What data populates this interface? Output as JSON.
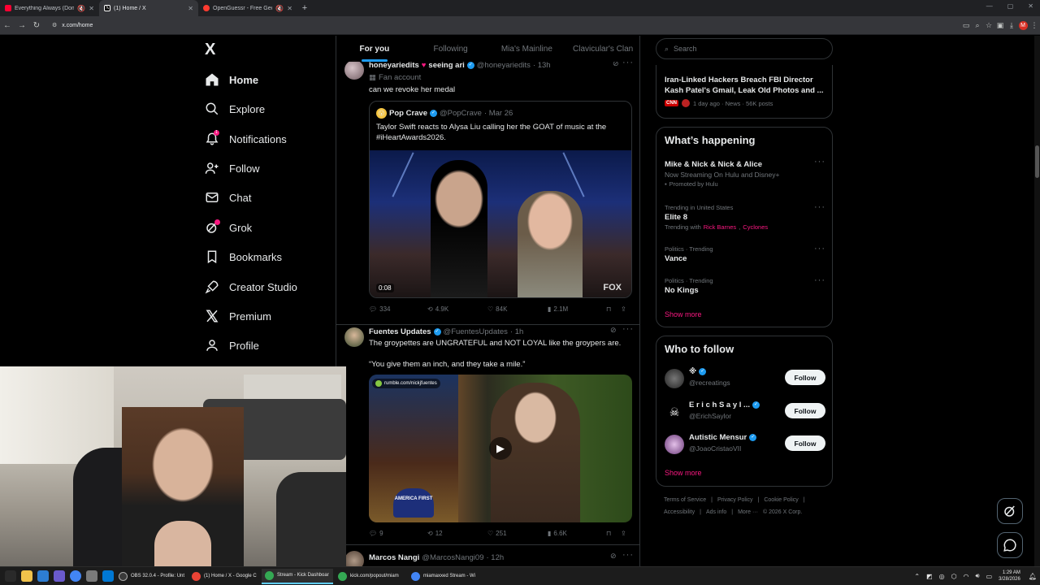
{
  "browser": {
    "tabs": [
      {
        "label": "Everything Always (Dom D",
        "fav_color": "#ff0033",
        "active": false
      },
      {
        "label": "(1) Home / X",
        "fav_color": "#ffffff",
        "active": true
      },
      {
        "label": "OpenGuessr - Free GeoGue",
        "fav_color": "#ff3b30",
        "active": false
      }
    ],
    "url": "x.com/home"
  },
  "left_nav": {
    "logo": "X",
    "items": [
      {
        "label": "Home",
        "icon": "home-icon"
      },
      {
        "label": "Explore",
        "icon": "search-icon"
      },
      {
        "label": "Notifications",
        "icon": "bell-icon",
        "badge": "1"
      },
      {
        "label": "Follow",
        "icon": "person-add-icon"
      },
      {
        "label": "Chat",
        "icon": "mail-icon"
      },
      {
        "label": "Grok",
        "icon": "grok-icon"
      },
      {
        "label": "Bookmarks",
        "icon": "bookmark-icon"
      },
      {
        "label": "Creator Studio",
        "icon": "rocket-icon"
      },
      {
        "label": "Premium",
        "icon": "x-icon"
      },
      {
        "label": "Profile",
        "icon": "person-icon"
      }
    ]
  },
  "feed": {
    "tabs": [
      "For you",
      "Following",
      "Mia's Mainline",
      "Clavicular's Clan"
    ],
    "posts": [
      {
        "name": "honeyariedits",
        "extra": "seeing ari",
        "handle": "@honeyariedits",
        "time": "· 13h",
        "badge": "Fan account",
        "text": "can we revoke her medal",
        "quote": {
          "name": "Pop Crave",
          "handle": "@PopCrave",
          "time": "· Mar 26",
          "text": "Taylor Swift reacts to Alysa Liu calling her the GOAT of music at the #iHeartAwards2026.",
          "duration": "0:08",
          "watermark": "FOX"
        },
        "stats": {
          "replies": "334",
          "reposts": "4.9K",
          "likes": "84K",
          "views": "2.1M"
        }
      },
      {
        "name": "Fuentes Updates",
        "handle": "@FuentesUpdates",
        "time": "· 1h",
        "text1": "The groypettes are UNGRATEFUL and NOT LOYAL like the groypers are.",
        "text2": "“You give them an inch, and they take a mile.”",
        "media_tag": "rumble.com/nickjfuentes",
        "cap_text": "AMERICA FIRST",
        "stats": {
          "replies": "9",
          "reposts": "12",
          "likes": "251",
          "views": "6.6K"
        }
      },
      {
        "name": "Marcos Nangi",
        "handle": "@MarcosNangi09",
        "time": "· 12h"
      }
    ]
  },
  "right": {
    "search_placeholder": "Search",
    "news": {
      "title": "Iran-Linked Hackers Breach FBI Director Kash Patel's Gmail, Leak Old Photos and ...",
      "meta": "1 day ago · News · 56K posts",
      "source": "CNN"
    },
    "happening": {
      "title": "What’s happening",
      "items": [
        {
          "context": "",
          "title": "Mike & Nick & Nick & Alice",
          "sub": "Now Streaming On Hulu and Disney+",
          "promo": "Promoted by Hulu"
        },
        {
          "context": "Trending in United States",
          "title": "Elite 8",
          "sub_prefix": "Trending with",
          "links": [
            "Rick Barnes",
            "Cyclones"
          ]
        },
        {
          "context": "Politics · Trending",
          "title": "Vance"
        },
        {
          "context": "Politics · Trending",
          "title": "No Kings"
        }
      ],
      "show_more": "Show more"
    },
    "who_to_follow": {
      "title": "Who to follow",
      "accounts": [
        {
          "name": "※",
          "handle": "@recreatings",
          "button": "Follow"
        },
        {
          "name": "E r i c h  S a y l ...",
          "handle": "@ErichSaylor",
          "button": "Follow"
        },
        {
          "name": "Autistic Mensur",
          "handle": "@JoaoCristaoVII",
          "button": "Follow"
        }
      ],
      "show_more": "Show more"
    },
    "footer": {
      "line1": [
        "Terms of Service",
        "Privacy Policy",
        "Cookie Policy"
      ],
      "line2": [
        "Accessibility",
        "Ads info",
        "More ···",
        "© 2026 X Corp."
      ]
    }
  },
  "taskbar": {
    "apps": [
      {
        "label": "OBS 32.0.4 - Profile: Unt",
        "color": "#3a3a3a",
        "active": false
      },
      {
        "label": "(1) Home / X - Google C",
        "color": "#ea4335",
        "active": false
      },
      {
        "label": "Stream - Kick Dashboar",
        "color": "#34a853",
        "active": true
      },
      {
        "label": "kick.com/popout/miam",
        "color": "#34a853",
        "active": false
      },
      {
        "label": "miamaxxed Stream - Wi",
        "color": "#4285f4",
        "active": false
      }
    ],
    "time": "1:29 AM",
    "date": "3/28/2026"
  }
}
